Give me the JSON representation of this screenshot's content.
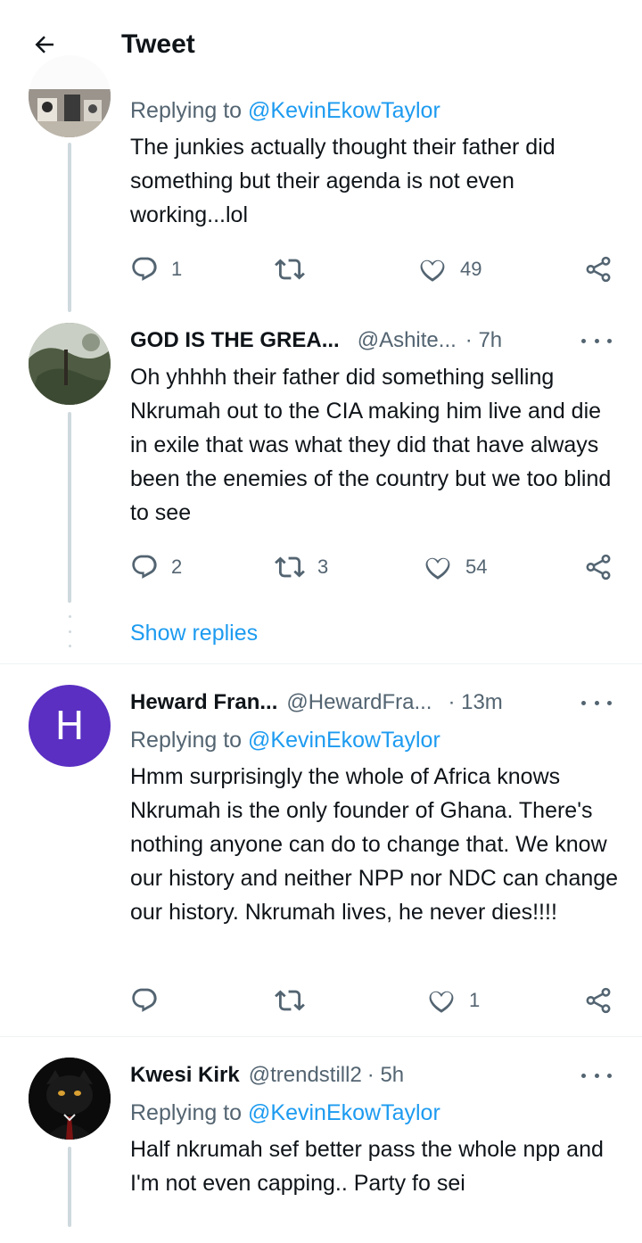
{
  "header": {
    "title": "Tweet"
  },
  "tweets": [
    {
      "reply_prefix": "Replying to",
      "reply_handle": "@KevinEkowTaylor",
      "text": "The junkies actually thought their father did something but their agenda is not even working...lol",
      "replies": "1",
      "retweets": "",
      "likes": "49"
    },
    {
      "name": "GOD IS THE GREA...",
      "handle": "@Ashite...",
      "time": "· 7h",
      "text": "Oh yhhhh their father did something selling Nkrumah out to the CIA making him live and die in exile that was what they did that have always been the enemies of the country but we too blind to see",
      "replies": "2",
      "retweets": "3",
      "likes": "54"
    },
    {
      "name": "Heward Fran...",
      "handle": "@HewardFra...",
      "time": "· 13m",
      "avatar_letter": "H",
      "reply_prefix": "Replying to",
      "reply_handle": "@KevinEkowTaylor",
      "text": "Hmm surprisingly the whole of Africa knows Nkrumah is the only founder of Ghana. There's nothing anyone can do to change that. We know our history and neither NPP nor NDC can change our history. Nkrumah lives, he never dies!!!!",
      "replies": "",
      "retweets": "",
      "likes": "1"
    },
    {
      "name": "Kwesi Kirk",
      "handle": "@trendstill2",
      "time": "· 5h",
      "reply_prefix": "Replying to",
      "reply_handle": "@KevinEkowTaylor",
      "text": "Half nkrumah sef better pass the whole npp and I'm not even capping.. Party fo sei"
    }
  ],
  "show_replies": "Show replies",
  "colors": {
    "accent": "#1d9bf0",
    "muted": "#536471",
    "avatar_h": "#5a2fc2",
    "thread_line": "#cfd9de"
  },
  "icons": [
    "back-arrow-icon",
    "more-icon",
    "reply-icon",
    "retweet-icon",
    "like-icon",
    "share-icon"
  ]
}
